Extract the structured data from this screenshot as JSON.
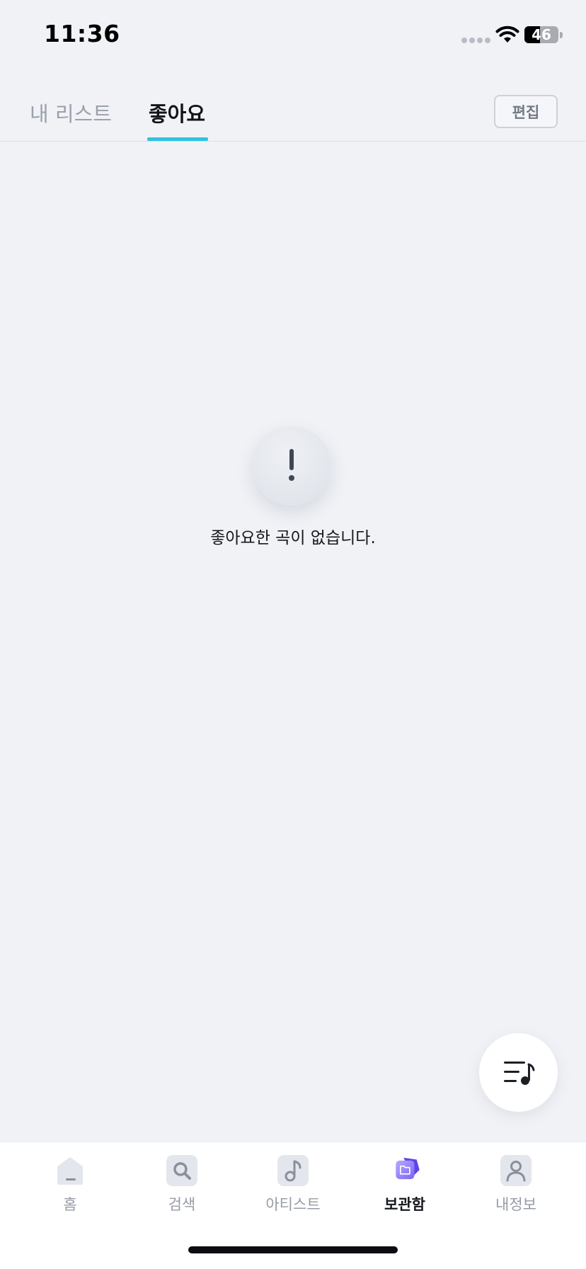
{
  "status_bar": {
    "time": "11:36",
    "battery": "46"
  },
  "header": {
    "tabs": [
      {
        "label": "내 리스트",
        "active": false
      },
      {
        "label": "좋아요",
        "active": true
      }
    ],
    "edit_label": "편집"
  },
  "empty_state": {
    "icon": "exclamation-icon",
    "message": "좋아요한 곡이 없습니다."
  },
  "fab": {
    "icon": "playlist-music-icon"
  },
  "bottom_nav": {
    "items": [
      {
        "label": "홈",
        "icon": "home-icon",
        "active": false
      },
      {
        "label": "검색",
        "icon": "search-icon",
        "active": false
      },
      {
        "label": "아티스트",
        "icon": "music-note-icon",
        "active": false
      },
      {
        "label": "보관함",
        "icon": "folder-icon",
        "active": true
      },
      {
        "label": "내정보",
        "icon": "person-icon",
        "active": false
      }
    ]
  },
  "colors": {
    "background": "#f1f2f6",
    "accent": "#2ec3e0",
    "active_nav": "#6f5cf0",
    "inactive_text": "#9aa0ac"
  }
}
